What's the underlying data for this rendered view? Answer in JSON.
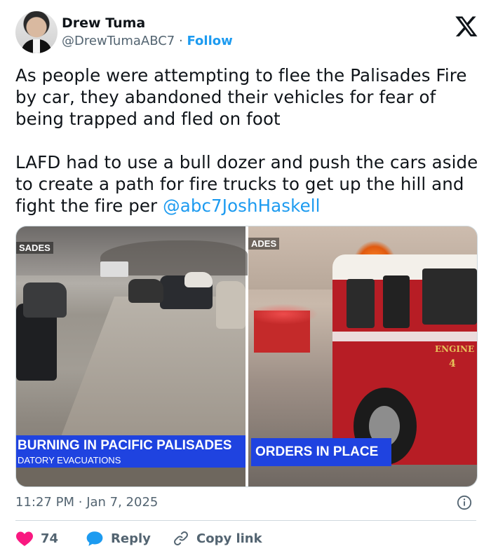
{
  "author": {
    "name": "Drew Tuma",
    "handle": "@DrewTumaABC7",
    "separator": "·",
    "follow_label": "Follow"
  },
  "tweet": {
    "paragraph1": "As people were attempting to flee the Palisades Fire by car, they abandoned their vehicles for fear of being trapped and fled on foot",
    "paragraph2_text": "LAFD had to use a bull dozer and push the cars aside to create a path for fire trucks to get up the hill and fight the fire per ",
    "paragraph2_mention": "@abc7JoshHaskell"
  },
  "media": {
    "left": {
      "corner_tag": "SADES",
      "chyron_line1": "BURNING IN PACIFIC PALISADES",
      "chyron_line2": "DATORY EVACUATIONS"
    },
    "right": {
      "corner_tag": "ADES",
      "chyron_line1": "ORDERS IN PLACE",
      "truck_label": "ENGINE",
      "truck_number": "4"
    }
  },
  "meta": {
    "time": "11:27 PM",
    "separator": "·",
    "date": "Jan 7, 2025"
  },
  "actions": {
    "likes": "74",
    "reply_label": "Reply",
    "copy_label": "Copy link"
  },
  "colors": {
    "accent": "#1d9bf0",
    "like": "#f91880",
    "chyron": "#1f43e0"
  },
  "icons": [
    "x-logo-icon",
    "heart-icon",
    "reply-bubble-icon",
    "link-icon",
    "info-icon"
  ]
}
